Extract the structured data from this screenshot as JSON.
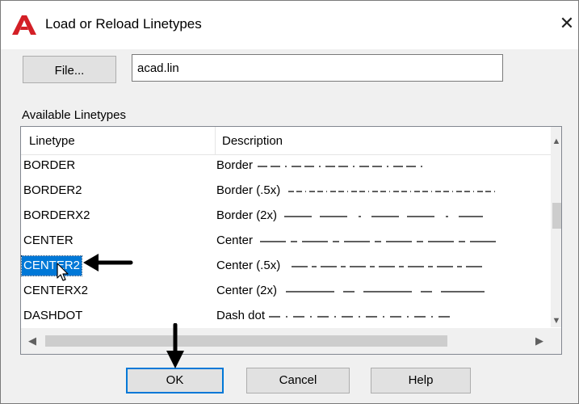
{
  "window": {
    "title": "Load or Reload Linetypes",
    "app_icon": "autocad-a-icon",
    "close_glyph": "✕"
  },
  "file": {
    "button_label": "File...",
    "value": "acad.lin"
  },
  "list": {
    "section_label": "Available Linetypes",
    "col_linetype": "Linetype",
    "col_description": "Description",
    "rows": [
      {
        "name": "BORDER",
        "desc": "Border",
        "pattern": "border"
      },
      {
        "name": "BORDER2",
        "desc": "Border (.5x)",
        "pattern": "border_half"
      },
      {
        "name": "BORDERX2",
        "desc": "Border (2x)",
        "pattern": "border_double"
      },
      {
        "name": "CENTER",
        "desc": "Center",
        "pattern": "center"
      },
      {
        "name": "CENTER2",
        "desc": "Center (.5x)",
        "pattern": "center_half"
      },
      {
        "name": "CENTERX2",
        "desc": "Center (2x)",
        "pattern": "center_double"
      },
      {
        "name": "DASHDOT",
        "desc": "Dash dot",
        "pattern": "dashdot"
      }
    ],
    "selected": "CENTER2"
  },
  "buttons": {
    "ok": "OK",
    "cancel": "Cancel",
    "help": "Help"
  },
  "colors": {
    "selection": "#0078d7",
    "accent_red": "#d31f26",
    "default_button_border": "#0078d7"
  }
}
